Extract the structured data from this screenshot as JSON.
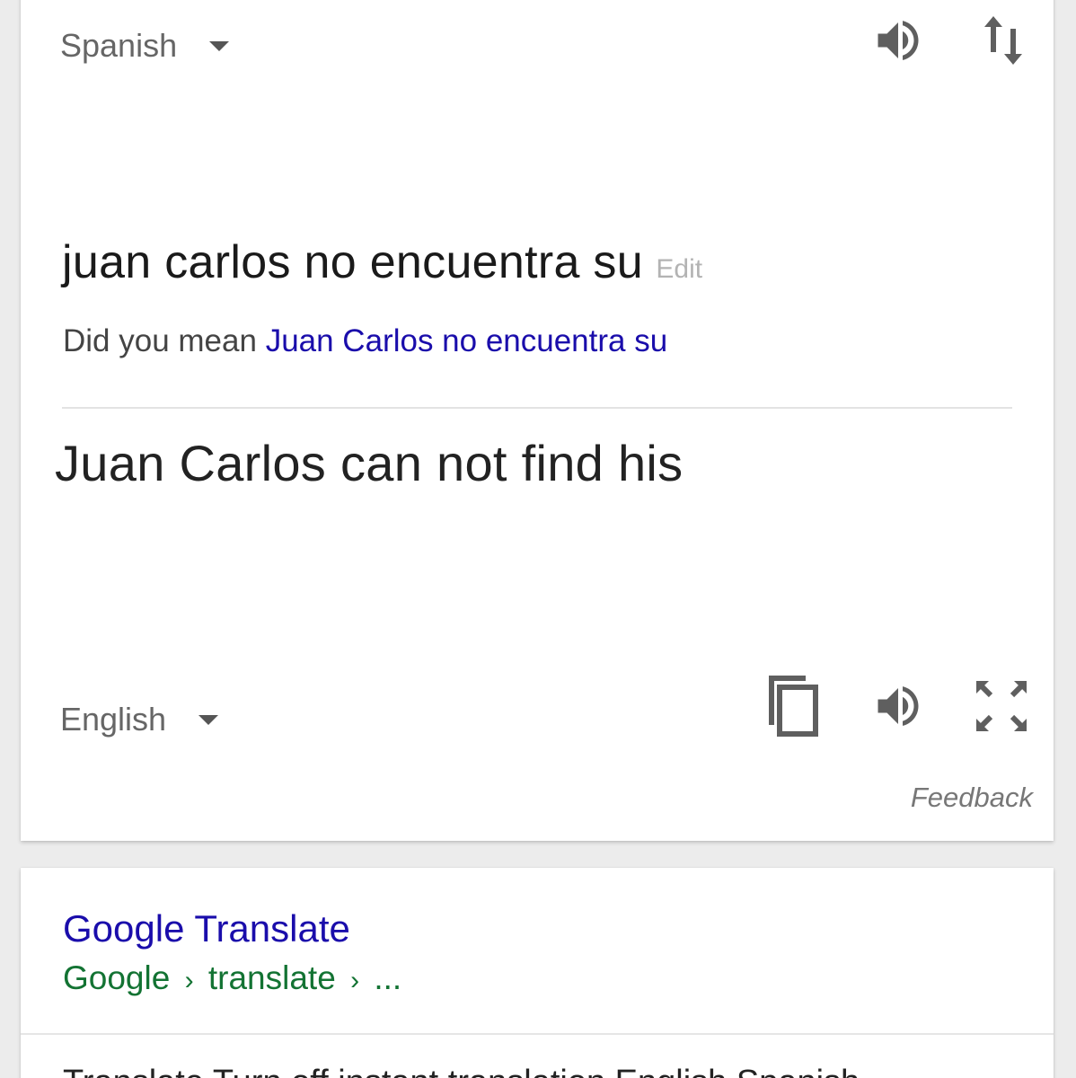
{
  "source": {
    "language": "Spanish",
    "text": "juan carlos no encuentra su",
    "edit_label": "Edit",
    "did_you_mean_label": "Did you mean",
    "did_you_mean_suggestion": "Juan Carlos no encuentra su"
  },
  "target": {
    "language": "English",
    "text": "Juan Carlos can not find his"
  },
  "feedback_label": "Feedback",
  "result": {
    "title": "Google Translate",
    "breadcrumb": [
      "Google",
      "translate",
      "..."
    ],
    "breadcrumb_separator": "›",
    "snippet": "Translate Turn off instant translation English Spanish"
  },
  "icons": {
    "source_speaker": "speaker-icon",
    "swap": "swap-languages-icon",
    "copy": "copy-icon",
    "target_speaker": "speaker-icon",
    "fullscreen": "fullscreen-icon"
  },
  "colors": {
    "link_blue": "#1a0dab",
    "url_green": "#137333",
    "icon_gray": "#5f5f5f"
  }
}
